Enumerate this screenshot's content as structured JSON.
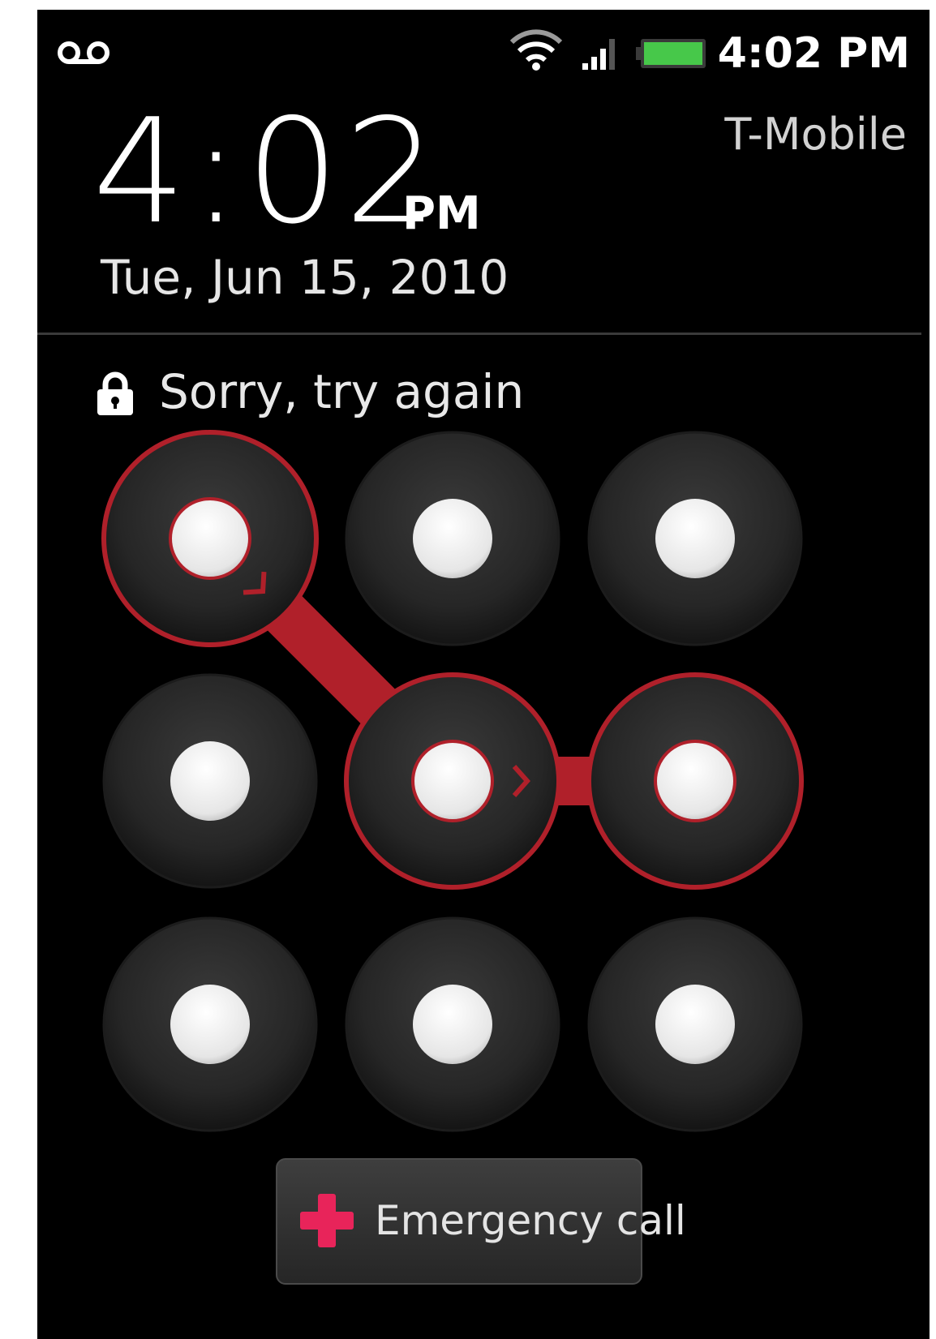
{
  "status_bar": {
    "time": "4:02 PM",
    "icons": [
      "voicemail-icon",
      "wifi-icon",
      "signal-icon",
      "battery-icon"
    ],
    "battery_color": "#47c84a"
  },
  "carrier": "T-Mobile",
  "clock": {
    "time": "4:02",
    "ampm": "PM",
    "date": "Tue, Jun 15, 2010"
  },
  "lock": {
    "icon": "lock-icon",
    "message": "Sorry, try again"
  },
  "pattern": {
    "grid_size": 3,
    "active_dots": [
      0,
      4,
      5
    ],
    "error_color": "#b0202a"
  },
  "emergency": {
    "icon": "red-cross-icon",
    "label": "Emergency call",
    "icon_color": "#e8245a"
  }
}
